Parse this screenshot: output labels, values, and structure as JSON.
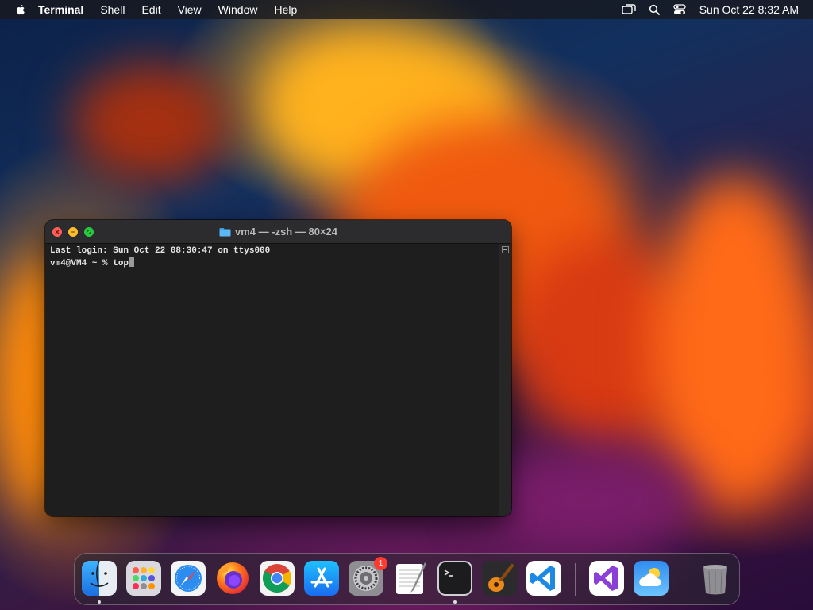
{
  "menubar": {
    "app_name": "Terminal",
    "menus": [
      "Shell",
      "Edit",
      "View",
      "Window",
      "Help"
    ],
    "clock": "Sun Oct 22  8:32 AM",
    "status_icons": [
      "screen-mirroring-icon",
      "search-icon",
      "control-center-icon"
    ]
  },
  "terminal": {
    "title": "vm4 — -zsh — 80×24",
    "lines": [
      "Last login: Sun Oct 22 08:30:47 on ttys000",
      "vm4@VM4 ~ % top"
    ]
  },
  "dock": {
    "apps": [
      {
        "name": "finder-icon",
        "running": true
      },
      {
        "name": "launchpad-icon",
        "running": false
      },
      {
        "name": "safari-icon",
        "running": false
      },
      {
        "name": "firefox-icon",
        "running": false
      },
      {
        "name": "chrome-icon",
        "running": false
      },
      {
        "name": "app-store-icon",
        "running": false
      },
      {
        "name": "system-settings-icon",
        "running": false,
        "badge": "1"
      },
      {
        "name": "textedit-icon",
        "running": false
      },
      {
        "name": "terminal-icon",
        "running": true
      },
      {
        "name": "garageband-icon",
        "running": false
      },
      {
        "name": "vscode-icon",
        "running": false
      },
      {
        "name": "visual-studio-icon",
        "running": false
      },
      {
        "name": "weather-icon",
        "running": false
      },
      {
        "name": "trash-icon",
        "running": false
      }
    ]
  }
}
